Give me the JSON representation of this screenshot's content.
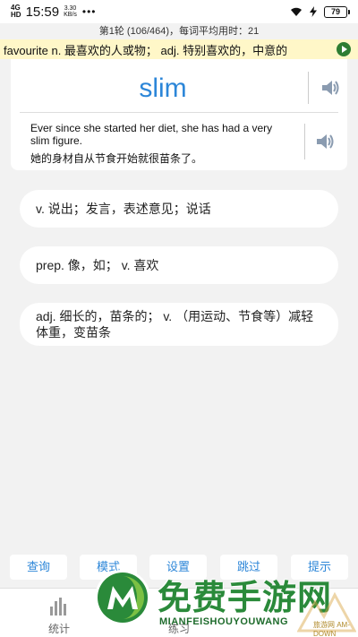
{
  "status_bar": {
    "network": "4G",
    "network_sub": "HD",
    "time": "15:59",
    "speed_value": "3.30",
    "speed_unit": "KB/s",
    "dots": "•••",
    "battery": "79"
  },
  "progress": {
    "text": "第1轮 (106/464)，每词平均用时：21"
  },
  "marquee": {
    "text": "favourite n. 最喜欢的人或物；   adj. 特别喜欢的，中意的"
  },
  "word_card": {
    "word": "slim",
    "example_en": "Ever since she started her diet, she has had a very slim figure.",
    "example_cn": "她的身材自从节食开始就很苗条了。"
  },
  "options": [
    {
      "text": "v. 说出；发言，表述意见；说话"
    },
    {
      "text": "prep. 像，如；   v. 喜欢"
    },
    {
      "text": "adj. 细长的，苗条的；   v. （用运动、节食等）减轻体重，变苗条"
    }
  ],
  "actions": {
    "lookup": "查询",
    "mode": "模式",
    "settings": "设置",
    "skip": "跳过",
    "hint": "提示"
  },
  "nav": {
    "stats": "统计",
    "practice": "练习"
  },
  "watermark": {
    "title": "免费手游网",
    "subtitle": "MIANFEISHOUYOUWANG",
    "corner": "旅游网 AM-DOWN"
  },
  "colors": {
    "accent": "#2c86d8",
    "marquee_bg": "#fff7c8",
    "background": "#f2f2f2",
    "watermark_green": "#2a8a3a"
  }
}
